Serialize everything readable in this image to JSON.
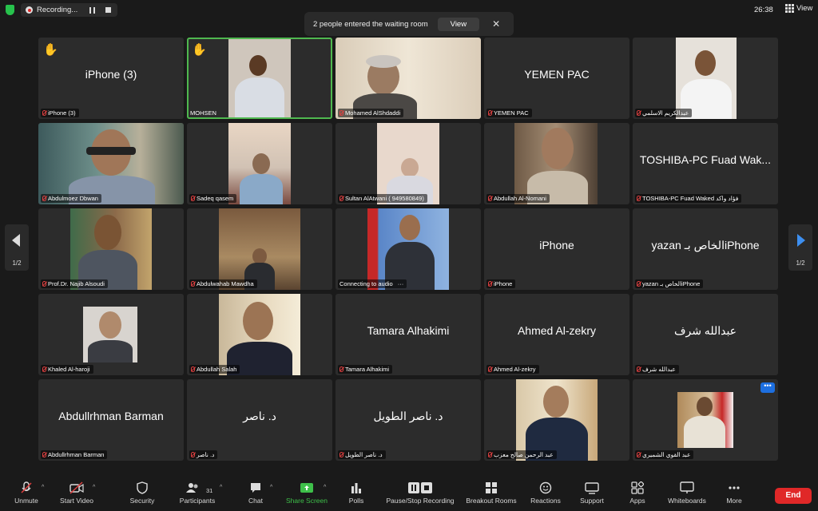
{
  "top_bar": {
    "recording_label": "Recording...",
    "timer": "26:38",
    "view_label": "View"
  },
  "waiting_banner": {
    "text": "2 people entered the waiting room",
    "view_button": "View"
  },
  "pager": {
    "left": "1/2",
    "right": "1/2"
  },
  "tiles": [
    {
      "center_name": "iPhone (3)",
      "label": "iPhone (3)",
      "hand": true
    },
    {
      "center_name": "",
      "label": "MOHSEN",
      "hand": true,
      "active": true
    },
    {
      "center_name": "",
      "label": "Mohamed AlShdaddi"
    },
    {
      "center_name": "YEMEN PAC",
      "label": "YEMEN PAC"
    },
    {
      "center_name": "",
      "label": "عبدالكريم الاسلمي"
    },
    {
      "center_name": "",
      "label": "Abdulmoez Dbwan"
    },
    {
      "center_name": "",
      "label": "Sadeq qasem"
    },
    {
      "center_name": "",
      "label": "Sultan AlAtwani ( 949580849)"
    },
    {
      "center_name": "",
      "label": "Abdullah Al-Nomani"
    },
    {
      "center_name": "TOSHIBA-PC Fuad Wak...",
      "label": "TOSHIBA-PC Fuad Waked فؤاد واكد"
    },
    {
      "center_name": "",
      "label": "Prof.Dr. Najib Alsoudi"
    },
    {
      "center_name": "",
      "label": "Abdulwahab Mawdha"
    },
    {
      "center_name": "",
      "label": "Connecting to audio"
    },
    {
      "center_name": "iPhone",
      "label": "iPhone"
    },
    {
      "center_name": "yazan الخاص بـiPhone",
      "label": "yazan الخاص بـiPhone"
    },
    {
      "center_name": "",
      "label": "Khaled Al-haroji"
    },
    {
      "center_name": "",
      "label": "Abdullah Salah"
    },
    {
      "center_name": "Tamara Alhakimi",
      "label": "Tamara Alhakimi"
    },
    {
      "center_name": "Ahmed Al-zekry",
      "label": "Ahmed Al-zekry"
    },
    {
      "center_name": "عبدالله شرف",
      "label": "عبدالله شرف"
    },
    {
      "center_name": "Abdullrhman Barman",
      "label": "Abdullrhman Barman"
    },
    {
      "center_name": "د. ناصر",
      "label": "د. ناصر"
    },
    {
      "center_name": "د. ناصر الطويل",
      "label": "د. ناصر الطويل"
    },
    {
      "center_name": "",
      "label": "عبد الرحمن صالح معزب"
    },
    {
      "center_name": "",
      "label": "عبد القوي الشميري",
      "more": true
    }
  ],
  "toolbar": {
    "unmute": "Unmute",
    "start_video": "Start Video",
    "security": "Security",
    "participants": "Participants",
    "participants_count": "31",
    "chat": "Chat",
    "share_screen": "Share Screen",
    "polls": "Polls",
    "recording": "Pause/Stop Recording",
    "breakout": "Breakout Rooms",
    "reactions": "Reactions",
    "support": "Support",
    "apps": "Apps",
    "whiteboards": "Whiteboards",
    "more": "More",
    "end": "End"
  },
  "colors": {
    "active_speaker": "#4fb84f",
    "end_button": "#e02828",
    "share_screen": "#3ec04a",
    "accent_blue": "#1d6fe0"
  }
}
